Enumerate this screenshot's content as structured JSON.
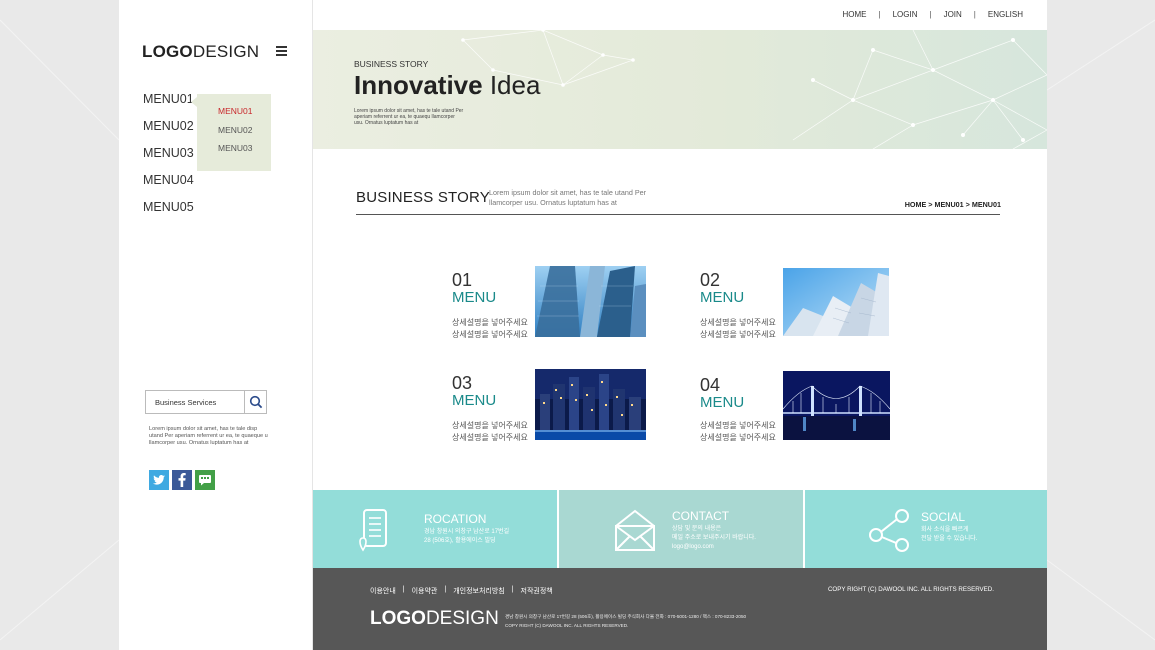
{
  "topnav": {
    "home": "HOME",
    "login": "LOGIN",
    "join": "JOIN",
    "english": "ENGLISH",
    "sep": "|"
  },
  "logo": {
    "bold": "LOGO",
    "light": "DESIGN"
  },
  "menu": [
    "MENU01",
    "MENU02",
    "MENU03",
    "MENU04",
    "MENU05"
  ],
  "submenu": [
    {
      "label": "MENU01",
      "active": true
    },
    {
      "label": "MENU02",
      "active": false
    },
    {
      "label": "MENU03",
      "active": false
    }
  ],
  "search": {
    "value": "Business Services"
  },
  "side_text": "Lorem ipsum dolor sit amet, has te tale disp utand Per aperiam referrent ur ea, te quaeque u llamcorper usu. Ornatus luptatum has at",
  "hero": {
    "kicker": "BUSINESS STORY",
    "title_bold": "Innovative",
    "title_light": " Idea",
    "small": "Lorem ipsum dolor sit amet, has te tale utand Per aperiam referrent ur ea, te quaequ llamcorper usu. Ornatus luptatum has at"
  },
  "section": {
    "title": "BUSINESS STORY",
    "desc": "Lorem ipsum dolor sit amet, has te tale utand Per llamcorper usu. Ornatus luptatum has at",
    "breadcrumb": "HOME > MENU01 > MENU01"
  },
  "cards": [
    {
      "num": "01",
      "label": "MENU",
      "line1": "상세설명을 넣어주세요",
      "line2": "상세설명을 넣어주세요",
      "photo": "skyscrapers-up-photo"
    },
    {
      "num": "02",
      "label": "MENU",
      "line1": "상세설명을 넣어주세요",
      "line2": "상세설명을 넣어주세요",
      "photo": "apartment-towers-photo"
    },
    {
      "num": "03",
      "label": "MENU",
      "line1": "상세설명을 넣어주세요",
      "line2": "상세설명을 넣어주세요",
      "photo": "night-city-photo"
    },
    {
      "num": "04",
      "label": "MENU",
      "line1": "상세설명을 넣어주세요",
      "line2": "상세설명을 넣어주세요",
      "photo": "bridge-night-photo"
    }
  ],
  "info": [
    {
      "title": "ROCATION",
      "text": "경남 창원시 의창구 남산로 17번길\n28 (506호), 활용에이스 빌딩",
      "icon": "location-document-icon",
      "color": "#93ddd9"
    },
    {
      "title": "CONTACT",
      "text": "상담 및 문의 내용은\n메일 주소로 보내주시기 바랍니다.\nlogo@logo.com",
      "icon": "envelope-icon",
      "color": "#a9d8d2"
    },
    {
      "title": "SOCIAL",
      "text": "회사 소식을 빠르게\n전달 받을 수 있습니다.",
      "icon": "share-icon",
      "color": "#93ddd9"
    }
  ],
  "footer": {
    "links": [
      "이용안내",
      "이용약관",
      "개인정보처리방침",
      "저작권정책"
    ],
    "copy_right": "COPY RIGHT (C) DAWOOL INC. ALL RIGHTS RESERVED.",
    "logo_bold": "LOGO",
    "logo_light": "DESIGN",
    "address": "경남 창원시 의창구 남산로 17번길 28 (506호), 활용에이스 빌딩 주식회사 다울 전화 : 070-5001-1280 / 팩스 : 070-8233-2050",
    "copy_small": "COPY RIGHT (C) DAWOOL INC. ALL RIGHTS RESERVED."
  }
}
